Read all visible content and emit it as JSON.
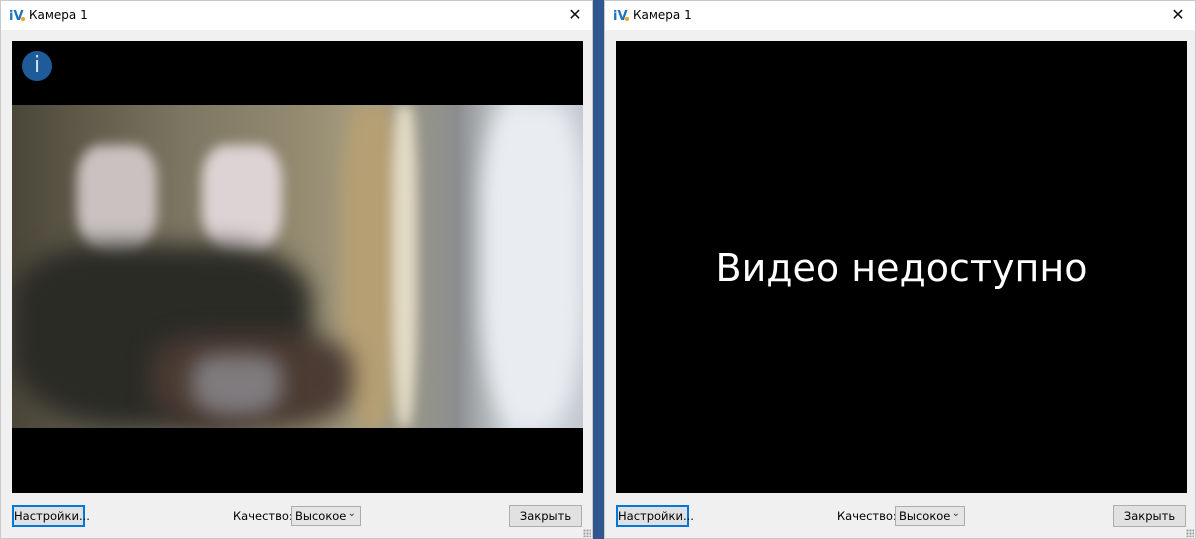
{
  "windows": [
    {
      "title": "Камера 1",
      "video_status": "playing",
      "buttons": {
        "settings": "Настройки...",
        "close": "Закрыть"
      },
      "quality": {
        "label": "Качество:",
        "value": "Высокое"
      }
    },
    {
      "title": "Камера 1",
      "video_status": "unavailable",
      "no_video_message": "Видео недоступно",
      "buttons": {
        "settings": "Настройки...",
        "close": "Закрыть"
      },
      "quality": {
        "label": "Качество:",
        "value": "Высокое"
      }
    }
  ],
  "colors": {
    "desktop": "#31578f",
    "window_bg": "#f0f0f0",
    "video_bg": "#000000",
    "focus_border": "#0078d7",
    "info_icon": "#1f5b98"
  },
  "icons": {
    "app": "iv-app-icon",
    "close": "close-icon",
    "info": "info-icon",
    "dropdown": "chevron-down-icon"
  }
}
